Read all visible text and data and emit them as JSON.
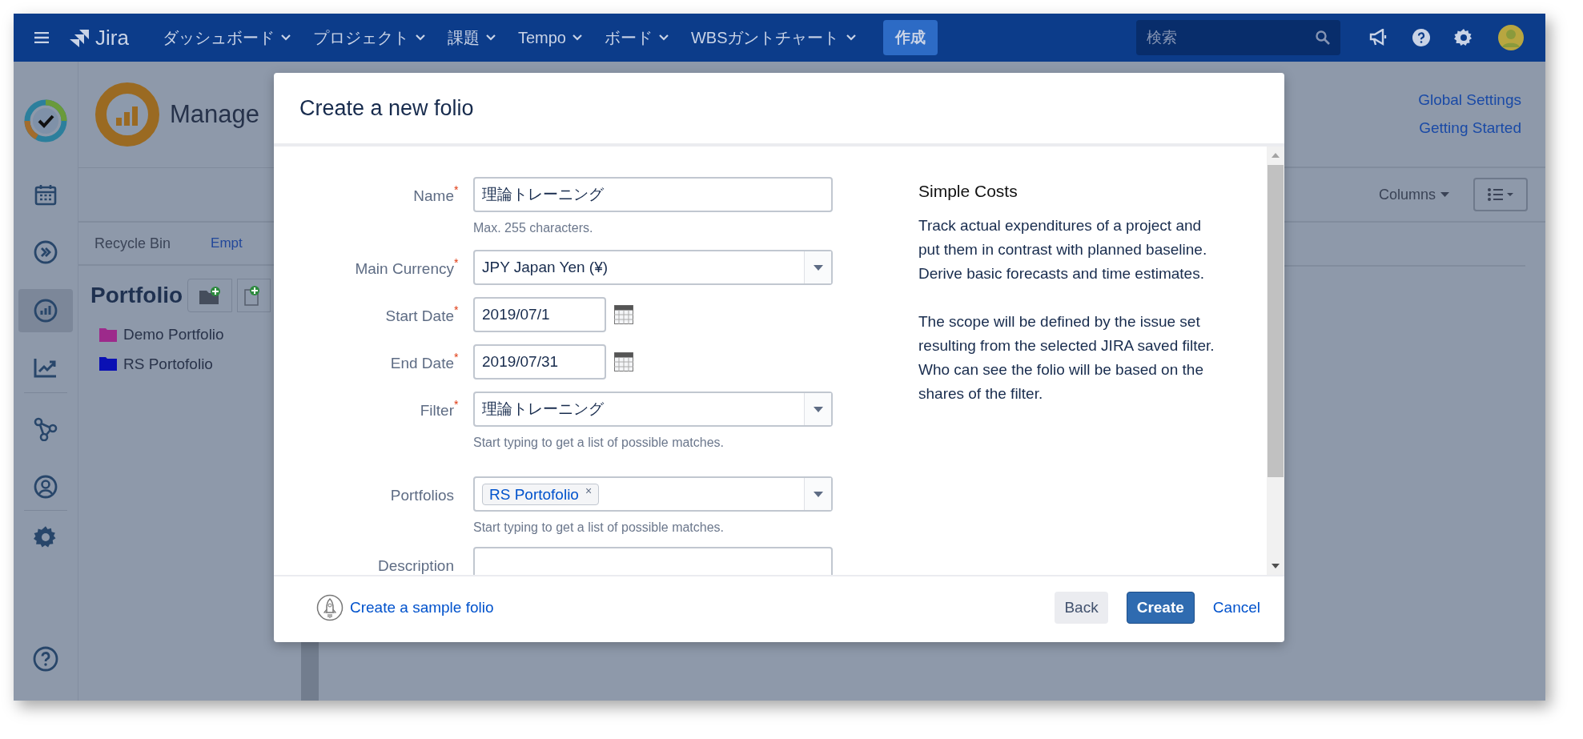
{
  "top_nav": {
    "product": "Jira",
    "menus": [
      {
        "label": "ダッシュボード"
      },
      {
        "label": "プロジェクト"
      },
      {
        "label": "課題"
      },
      {
        "label": "Tempo"
      },
      {
        "label": "ボード"
      },
      {
        "label": "WBSガントチャート"
      }
    ],
    "create_button": "作成",
    "search": {
      "placeholder": "検索"
    }
  },
  "sidebar": {
    "items": [
      {
        "selected": false
      },
      {
        "selected": false
      },
      {
        "selected": false
      },
      {
        "selected": true
      },
      {
        "selected": false
      },
      {
        "selected": false
      },
      {
        "selected": false
      }
    ]
  },
  "page": {
    "title": "Manage",
    "links": [
      "Global Settings",
      "Getting Started"
    ],
    "columns_button": "Columns",
    "recycle_bin": {
      "label": "Recycle Bin",
      "action": "Empt"
    },
    "portfolios": {
      "heading": "Portfolio",
      "items": [
        {
          "label": "Demo Portfolio",
          "color": "#9d2a8b"
        },
        {
          "label": "RS Portofolio",
          "color": "#0a10b4"
        }
      ]
    }
  },
  "dialog": {
    "title": "Create a new folio",
    "fields": [
      {
        "kind": "text",
        "label": "Name",
        "required_mark": "*",
        "value": "理論トレーニング",
        "help": "Max. 255 characters."
      },
      {
        "kind": "select",
        "label": "Main Currency",
        "required_mark": "*",
        "value": "JPY Japan Yen (¥)"
      },
      {
        "kind": "date",
        "label": "Start Date",
        "required_mark": "*",
        "value": "2019/07/1"
      },
      {
        "kind": "date",
        "label": "End Date",
        "required_mark": "*",
        "value": "2019/07/31"
      },
      {
        "kind": "select",
        "label": "Filter",
        "required_mark": "*",
        "value": "理論トレーニング",
        "help": "Start typing to get a list of possible matches."
      },
      {
        "kind": "tags",
        "label": "Portfolios",
        "tags": [
          {
            "label": "RS Portofolio",
            "remove": "×"
          }
        ],
        "help": "Start typing to get a list of possible matches."
      },
      {
        "kind": "textarea",
        "label": "Description"
      }
    ],
    "info": {
      "title": "Simple Costs",
      "paragraphs": [
        "Track actual expenditures of a project and put them in contrast with planned baseline. Derive basic forecasts and time estimates.",
        "The scope will be defined by the issue set resulting from the selected JIRA saved filter. Who can see the folio will be based on the shares of the filter."
      ]
    },
    "footer": {
      "sample_link": "Create a sample folio",
      "buttons": [
        {
          "kind": "secondary",
          "label": "Back"
        },
        {
          "kind": "primary",
          "label": "Create"
        },
        {
          "kind": "link",
          "label": "Cancel"
        }
      ]
    }
  }
}
